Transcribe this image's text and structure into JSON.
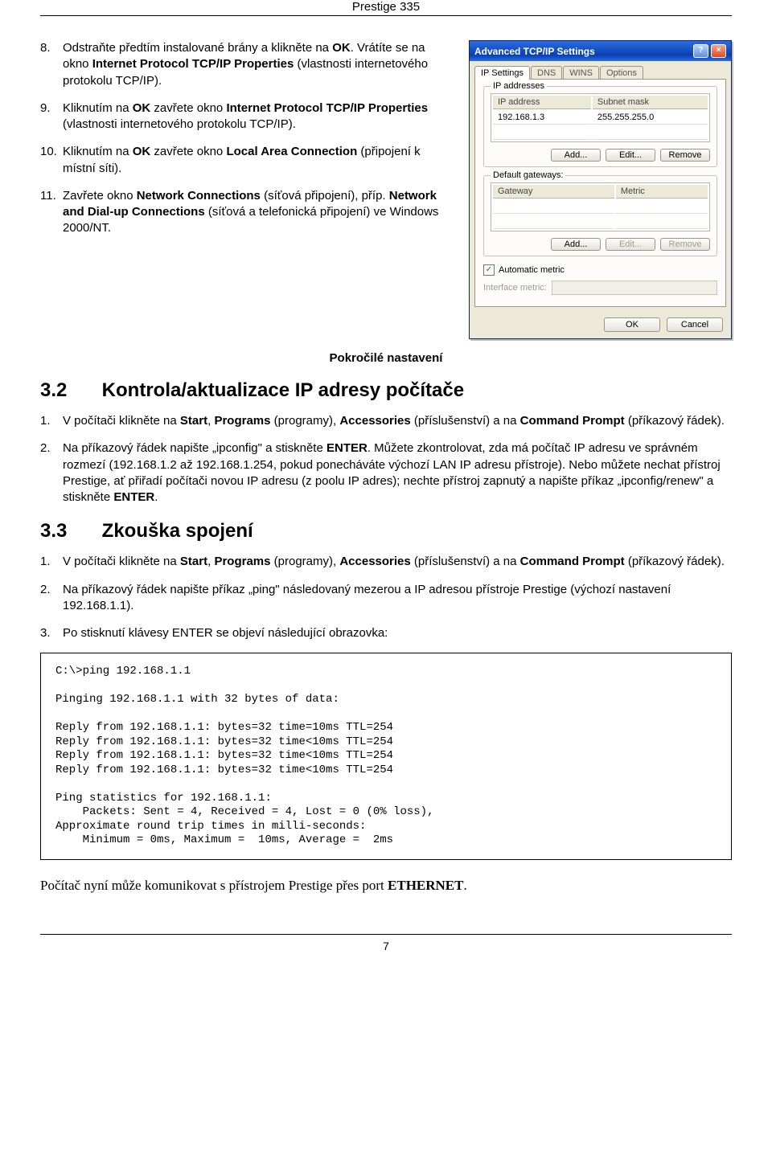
{
  "header": {
    "title": "Prestige 335"
  },
  "steps_a": [
    {
      "num": "8.",
      "frags": [
        {
          "t": "Odstraňte předtím instalované brány a klikněte na "
        },
        {
          "t": "OK",
          "b": true
        },
        {
          "t": ". Vrátíte se na okno "
        },
        {
          "t": "Internet Protocol TCP/IP Properties",
          "b": true
        },
        {
          "t": " (vlastnosti internetového protokolu TCP/IP)."
        }
      ]
    },
    {
      "num": "9.",
      "frags": [
        {
          "t": "Kliknutím na "
        },
        {
          "t": "OK",
          "b": true
        },
        {
          "t": " zavřete okno "
        },
        {
          "t": "Internet Protocol TCP/IP Properties",
          "b": true
        },
        {
          "t": " (vlastnosti internetového protokolu TCP/IP)."
        }
      ]
    },
    {
      "num": "10.",
      "frags": [
        {
          "t": "Kliknutím na "
        },
        {
          "t": "OK",
          "b": true
        },
        {
          "t": " zavřete okno "
        },
        {
          "t": "Local Area Connection",
          "b": true
        },
        {
          "t": " (připojení k místní síti)."
        }
      ]
    },
    {
      "num": "11.",
      "frags": [
        {
          "t": "Zavřete okno "
        },
        {
          "t": "Network Connections",
          "b": true
        },
        {
          "t": " (síťová připojení), příp. "
        },
        {
          "t": "Network and Dial-up Connections",
          "b": true
        },
        {
          "t": " (síťová a telefonická připojení) ve Windows 2000/NT."
        }
      ]
    }
  ],
  "dialog": {
    "title": "Advanced TCP/IP Settings",
    "tabs": [
      "IP Settings",
      "DNS",
      "WINS",
      "Options"
    ],
    "ip_group": {
      "legend": "IP addresses",
      "cols": [
        "IP address",
        "Subnet mask"
      ],
      "row": [
        "192.168.1.3",
        "255.255.255.0"
      ],
      "btns": [
        "Add...",
        "Edit...",
        "Remove"
      ]
    },
    "gw_group": {
      "legend": "Default gateways:",
      "cols": [
        "Gateway",
        "Metric"
      ],
      "btns": [
        "Add...",
        "Edit...",
        "Remove"
      ]
    },
    "auto_metric": "Automatic metric",
    "iface_metric": "Interface metric:",
    "ok": "OK",
    "cancel": "Cancel"
  },
  "caption": "Pokročilé nastavení",
  "sec32": {
    "num": "3.2",
    "title": "Kontrola/aktualizace IP adresy počítače"
  },
  "steps_b": [
    {
      "num": "1.",
      "frags": [
        {
          "t": "V počítači klikněte na "
        },
        {
          "t": "Start",
          "b": true
        },
        {
          "t": ", "
        },
        {
          "t": "Programs",
          "b": true
        },
        {
          "t": " (programy), "
        },
        {
          "t": "Accessories",
          "b": true
        },
        {
          "t": " (příslušenství) a na "
        },
        {
          "t": "Command Prompt",
          "b": true
        },
        {
          "t": " (příkazový řádek)."
        }
      ]
    },
    {
      "num": "2.",
      "frags": [
        {
          "t": "Na příkazový řádek napište „ipconfig\" a stiskněte "
        },
        {
          "t": "ENTER",
          "b": true
        },
        {
          "t": ". Můžete zkontrolovat, zda má počítač IP adresu ve správném rozmezí (192.168.1.2 až 192.168.1.254, pokud ponecháváte výchozí LAN IP adresu přístroje). Nebo můžete nechat přístroj Prestige, ať přiřadí počítači novou IP adresu (z poolu IP adres); nechte přístroj zapnutý a napište příkaz „ipconfig/renew\" a stiskněte "
        },
        {
          "t": "ENTER",
          "b": true
        },
        {
          "t": "."
        }
      ]
    }
  ],
  "sec33": {
    "num": "3.3",
    "title": "Zkouška spojení"
  },
  "steps_c": [
    {
      "num": "1.",
      "frags": [
        {
          "t": "V počítači klikněte na "
        },
        {
          "t": "Start",
          "b": true
        },
        {
          "t": ", "
        },
        {
          "t": "Programs",
          "b": true
        },
        {
          "t": " (programy), "
        },
        {
          "t": "Accessories",
          "b": true
        },
        {
          "t": " (příslušenství) a na "
        },
        {
          "t": "Command Prompt",
          "b": true
        },
        {
          "t": " (příkazový řádek)."
        }
      ]
    },
    {
      "num": "2.",
      "frags": [
        {
          "t": "Na příkazový řádek napište příkaz „ping\" následovaný mezerou a IP adresou přístroje Prestige (výchozí nastavení 192.168.1.1)."
        }
      ]
    },
    {
      "num": "3.",
      "frags": [
        {
          "t": "Po stisknutí klávesy ENTER se objeví následující obrazovka:"
        }
      ]
    }
  ],
  "code": "C:\\>ping 192.168.1.1\n\nPinging 192.168.1.1 with 32 bytes of data:\n\nReply from 192.168.1.1: bytes=32 time=10ms TTL=254\nReply from 192.168.1.1: bytes=32 time<10ms TTL=254\nReply from 192.168.1.1: bytes=32 time<10ms TTL=254\nReply from 192.168.1.1: bytes=32 time<10ms TTL=254\n\nPing statistics for 192.168.1.1:\n    Packets: Sent = 4, Received = 4, Lost = 0 (0% loss),\nApproximate round trip times in milli-seconds:\n    Minimum = 0ms, Maximum =  10ms, Average =  2ms",
  "closing": {
    "pre": "Počítač nyní může komunikovat s přístrojem Prestige přes port ",
    "bold": "ETHERNET",
    "post": "."
  },
  "footer": {
    "page": "7"
  }
}
